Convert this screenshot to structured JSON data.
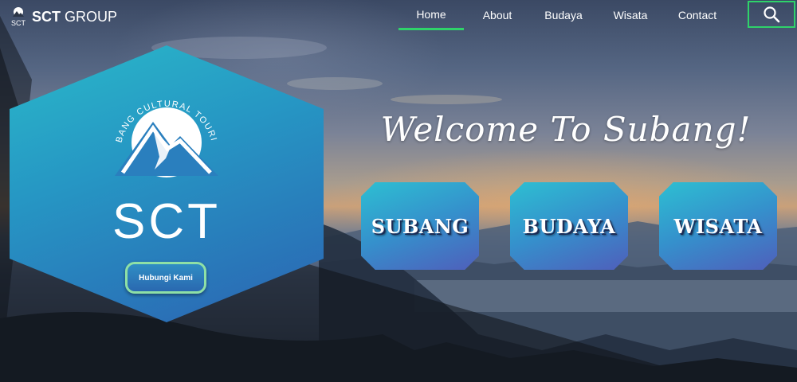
{
  "brand": {
    "logo_mark_text": "SCT",
    "name_bold": "SCT",
    "name_rest": "GROUP"
  },
  "nav": {
    "items": [
      {
        "label": "Home",
        "active": true
      },
      {
        "label": "About",
        "active": false
      },
      {
        "label": "Budaya",
        "active": false
      },
      {
        "label": "Wisata",
        "active": false
      },
      {
        "label": "Contact",
        "active": false
      }
    ],
    "search_icon": "search-icon"
  },
  "hero": {
    "emblem_arc_text": "SUBANG CULTURAL TOURISM",
    "emblem_title": "SCT",
    "contact_button": "Hubungi Kami",
    "welcome": "Welcome To Subang!"
  },
  "tiles": [
    {
      "label": "SUBANG"
    },
    {
      "label": "BUDAYA"
    },
    {
      "label": "WISATA"
    }
  ],
  "colors": {
    "accent_green": "#2fd36a",
    "hex_top": "#2ab9c9",
    "hex_bottom": "#2b63b2",
    "tile_top": "#2dbfd2",
    "tile_bottom": "#4f5fbb"
  }
}
